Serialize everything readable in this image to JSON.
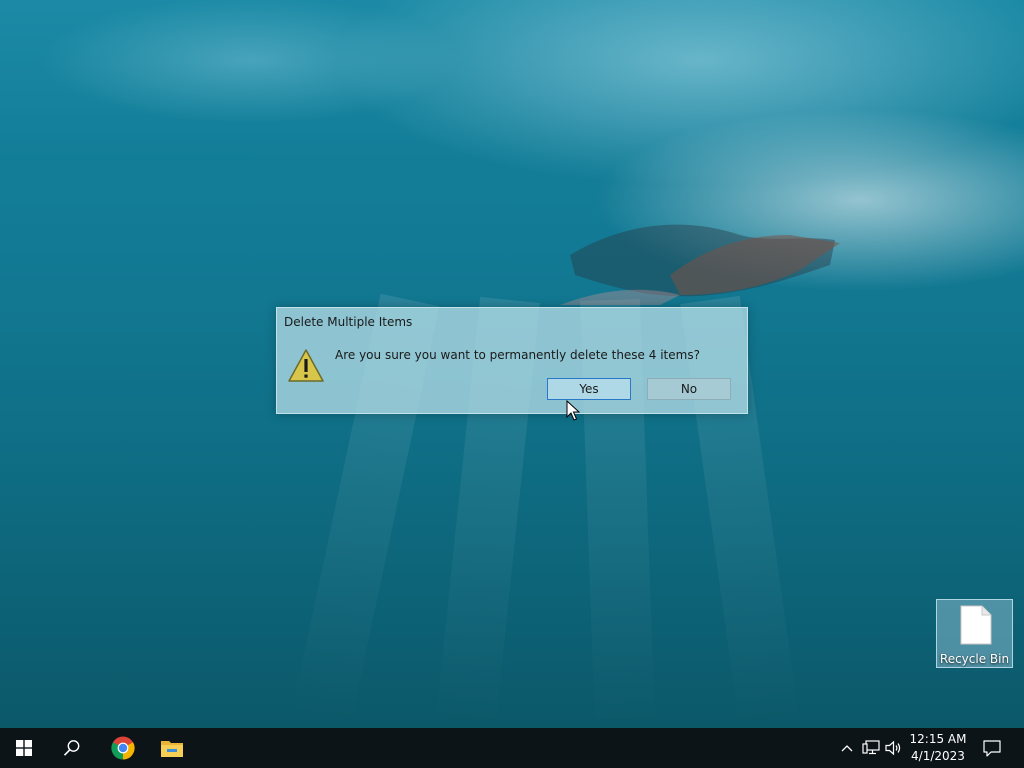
{
  "dialog": {
    "title": "Delete Multiple Items",
    "message": "Are you sure you want to permanently delete these 4 items?",
    "yes_label": "Yes",
    "no_label": "No",
    "icon": "warning-icon"
  },
  "desktop": {
    "icons": [
      {
        "label": "Recycle Bin",
        "icon": "file-icon"
      }
    ]
  },
  "taskbar": {
    "start_icon": "windows-icon",
    "search_icon": "search-icon",
    "pinned": [
      {
        "name": "Google Chrome",
        "icon": "chrome-icon"
      },
      {
        "name": "File Explorer",
        "icon": "folder-icon"
      }
    ],
    "tray": {
      "chevron_icon": "chevron-up-icon",
      "network_icon": "network-icon",
      "volume_icon": "volume-icon",
      "notification_icon": "notification-icon"
    },
    "clock": {
      "time": "12:15 AM",
      "date": "4/1/2023"
    }
  },
  "colors": {
    "taskbar_bg": "#0c1418",
    "dialog_bg": "#aad6e0",
    "yes_border": "#2a78c8"
  }
}
